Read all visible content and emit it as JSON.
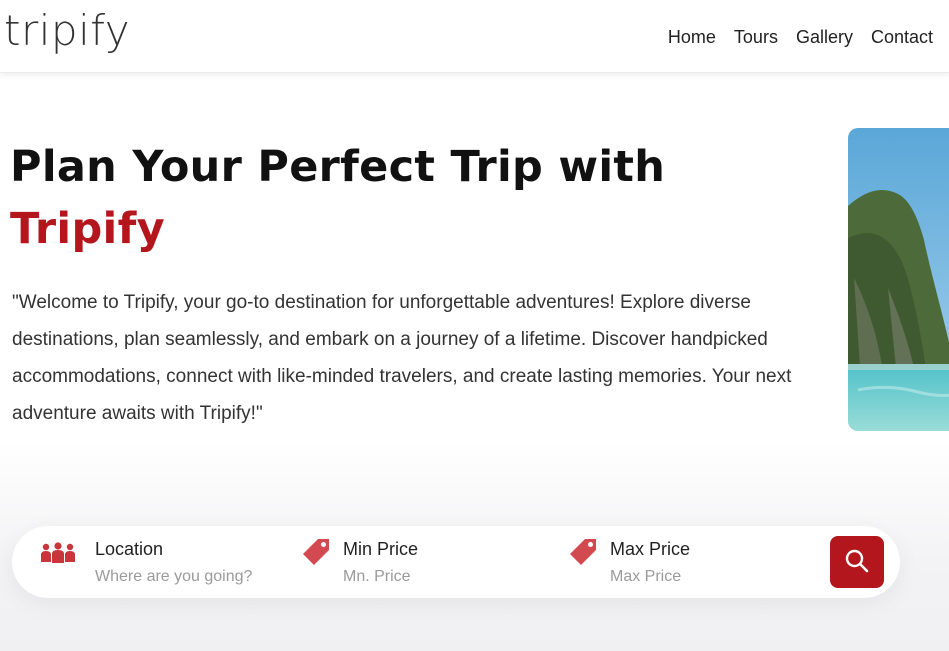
{
  "header": {
    "logo": "tripify",
    "nav": [
      "Home",
      "Tours",
      "Gallery",
      "Contact"
    ]
  },
  "hero": {
    "title": "Plan Your Perfect Trip with",
    "brand": "Tripify",
    "description": "\"Welcome to Tripify, your go-to destination for unforgettable adventures! Explore diverse destinations, plan seamlessly, and embark on a journey of a lifetime. Discover handpicked accommodations, connect with like-minded travelers, and create lasting memories. Your next adventure awaits with Tripify!\""
  },
  "search": {
    "location": {
      "label": "Location",
      "placeholder": "Where are you going?"
    },
    "min_price": {
      "label": "Min Price",
      "placeholder": "Mn. Price"
    },
    "max_price": {
      "label": "Max Price",
      "placeholder": "Max Price"
    }
  },
  "colors": {
    "accent": "#b3171d"
  },
  "icons": {
    "location": "people-group-icon",
    "min_price": "price-tag-icon",
    "max_price": "price-tag-icon",
    "search": "search-icon"
  }
}
